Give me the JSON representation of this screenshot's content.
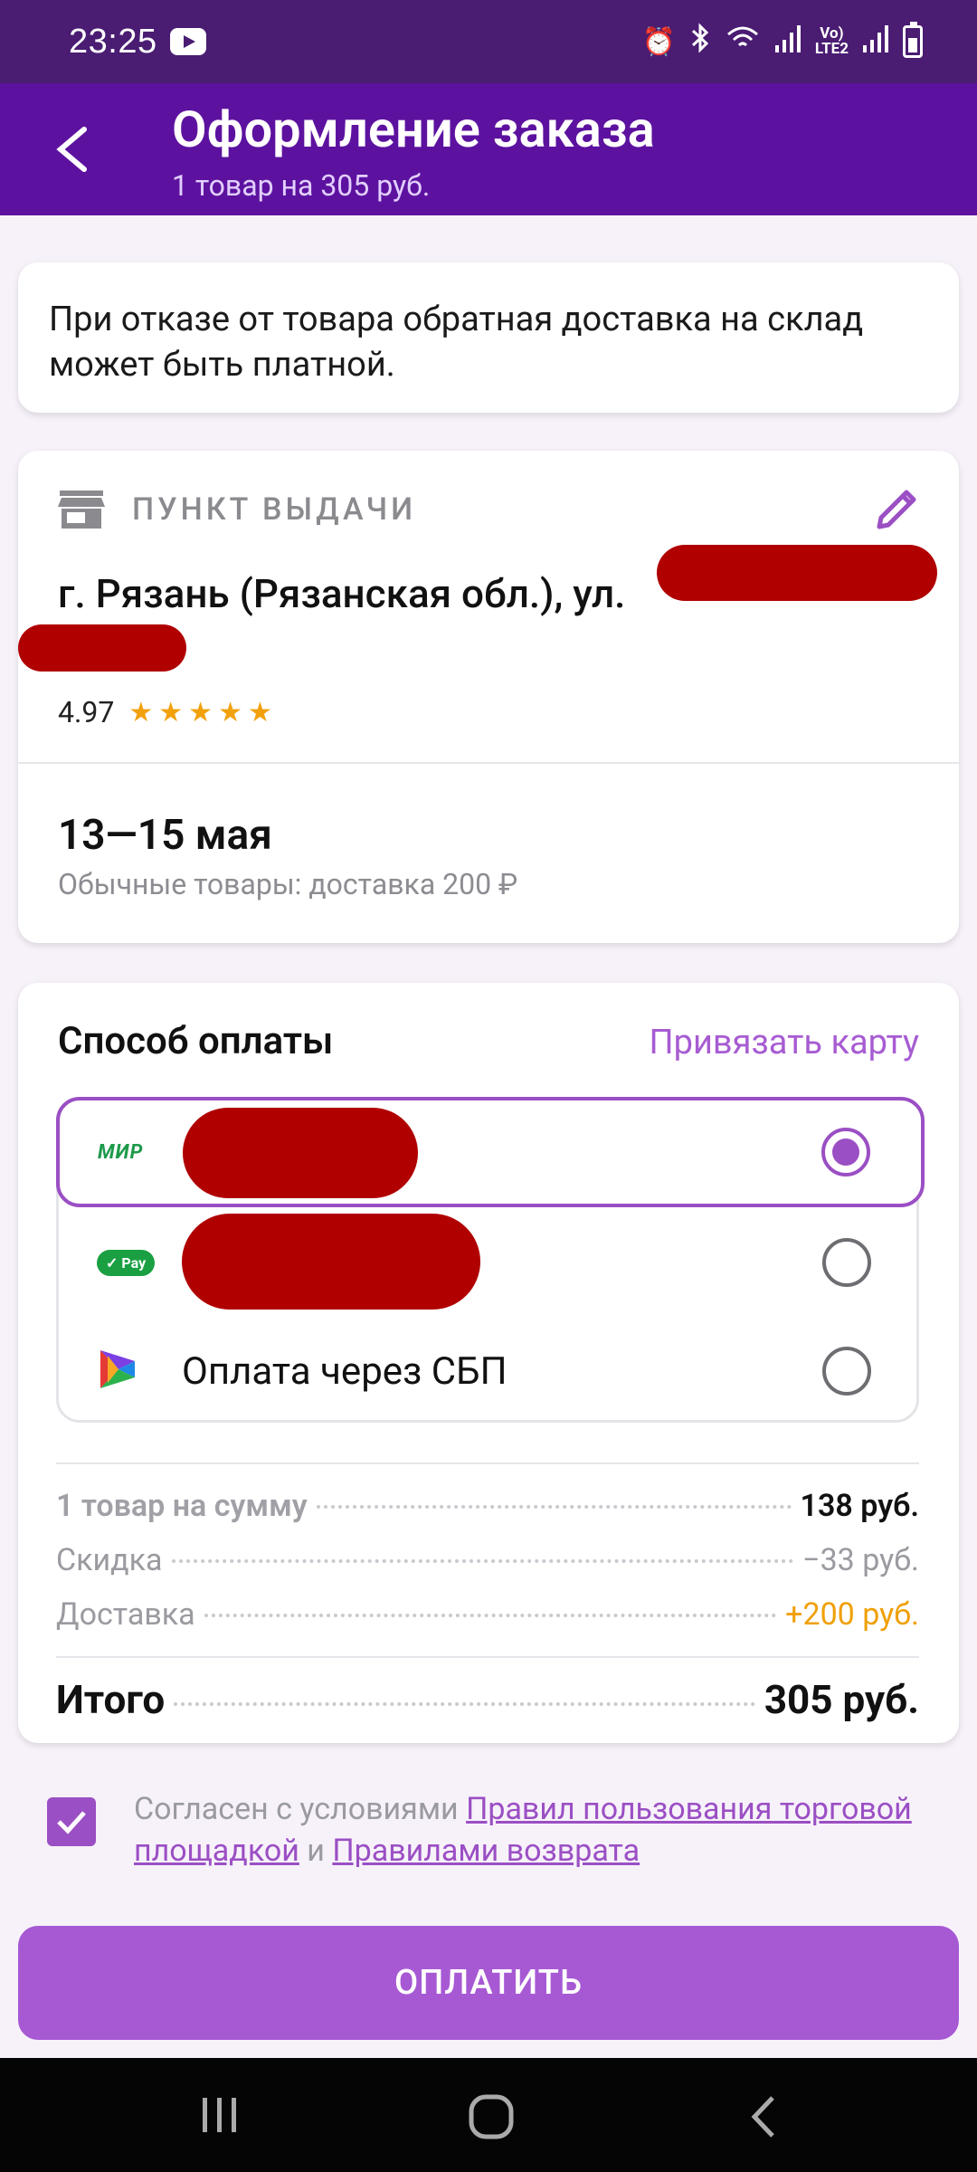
{
  "status_bar": {
    "time": "23:25"
  },
  "app_bar": {
    "title": "Оформление заказа",
    "subtitle": "1 товар на 305 руб."
  },
  "notice": {
    "text": "При отказе от товара обратная доставка на склад может быть платной."
  },
  "pickup": {
    "label": "ПУНКТ ВЫДАЧИ",
    "address": "г. Рязань (Рязанская обл.), ул.",
    "rating": "4.97",
    "stars": "★★★★★",
    "date": "13—15 мая",
    "delivery_note": "Обычные товары: доставка 200 ₽"
  },
  "payment": {
    "title": "Способ оплаты",
    "link_card": "Привязать карту",
    "methods": [
      {
        "logo": "МИР",
        "label": "",
        "selected": true
      },
      {
        "logo": "Pay",
        "label": "",
        "selected": false
      },
      {
        "logo": "sbp-icon",
        "label": "Оплата через СБП",
        "selected": false
      }
    ],
    "summary": {
      "items_label": "1 товар на сумму",
      "items_value": "138 руб.",
      "discount_label": "Скидка",
      "discount_value": "−33 руб.",
      "delivery_label": "Доставка",
      "delivery_value": "+200 руб.",
      "total_label": "Итого",
      "total_value": "305 руб."
    }
  },
  "agreement": {
    "text_prefix": "Согласен с условиями ",
    "link1": "Правил пользования торговой площадкой",
    "and": " и ",
    "link2": "Правилами возврата",
    "checked": true
  },
  "pay_button": {
    "label": "ОПЛАТИТЬ"
  },
  "colors": {
    "status_bar": "#4a1c72",
    "app_bar": "#5d129f",
    "accent": "#9b4fc4",
    "pay_button": "#a759d4",
    "star": "#f2a10d",
    "delivery_plus": "#f0a008"
  }
}
